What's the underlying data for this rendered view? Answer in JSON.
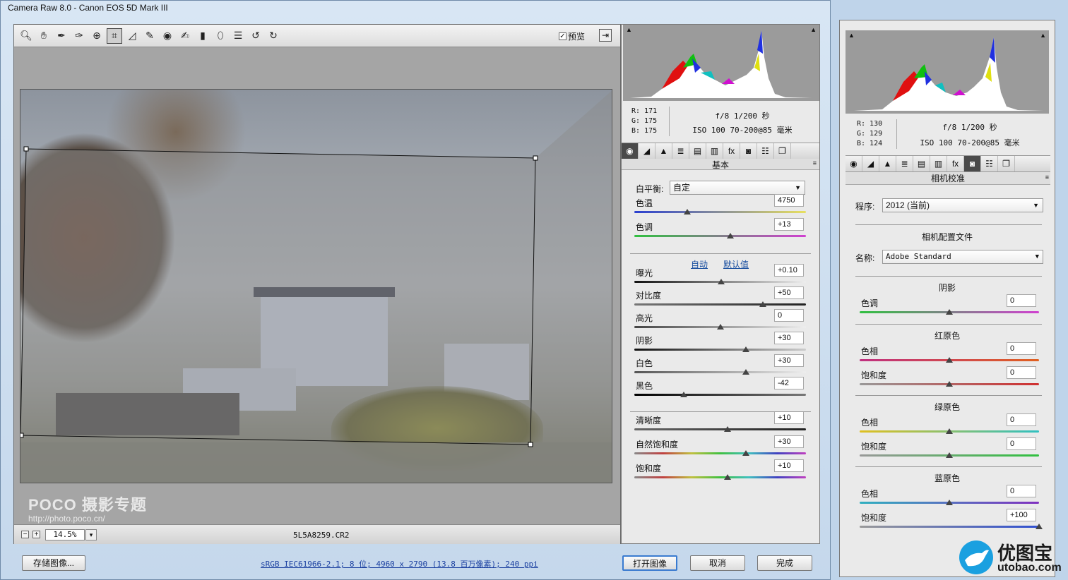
{
  "window": {
    "title": "Camera Raw 8.0 -  Canon EOS 5D Mark III"
  },
  "toolbar": {
    "preview_label": "预览",
    "preview_checked": "✓"
  },
  "statusbar": {
    "zoom": "14.5%",
    "filename": "5L5A8259.CR2",
    "minus": "−",
    "plus": "+",
    "dd": "▾"
  },
  "watermark": {
    "brand": "POCO 摄影专题",
    "url": "http://photo.poco.cn/"
  },
  "histogram": {
    "r": "R:  171",
    "g": "G:  175",
    "b": "B:  175",
    "aperture": "f/8   1/200 秒",
    "iso": "ISO 100   70-200@85 毫米"
  },
  "basic": {
    "title": "基本",
    "wb_label": "白平衡:",
    "wb_value": "自定",
    "auto": "自动",
    "default": "默认值",
    "sliders": [
      {
        "label": "色温",
        "value": "4750",
        "pos": 0.31,
        "grad": "linear-gradient(90deg,#2a3fd0,#e8e060)"
      },
      {
        "label": "色调",
        "value": "+13",
        "pos": 0.56,
        "grad": "linear-gradient(90deg,#30c040,#d040d0)"
      },
      {
        "label": "曝光",
        "value": "+0.10",
        "pos": 0.505,
        "grad": "linear-gradient(90deg,#111,#eee)"
      },
      {
        "label": "对比度",
        "value": "+50",
        "pos": 0.75,
        "grad": "linear-gradient(90deg,#777,#222)"
      },
      {
        "label": "高光",
        "value": "0",
        "pos": 0.5,
        "grad": "linear-gradient(90deg,#444,#eee)"
      },
      {
        "label": "阴影",
        "value": "+30",
        "pos": 0.65,
        "grad": "linear-gradient(90deg,#111,#ccc)"
      },
      {
        "label": "白色",
        "value": "+30",
        "pos": 0.65,
        "grad": "linear-gradient(90deg,#555,#eee)"
      },
      {
        "label": "黑色",
        "value": "-42",
        "pos": 0.29,
        "grad": "linear-gradient(90deg,#000,#777)"
      },
      {
        "label": "清晰度",
        "value": "+10",
        "pos": 0.545,
        "grad": "linear-gradient(90deg,#666,#222)"
      },
      {
        "label": "自然饱和度",
        "value": "+30",
        "pos": 0.65,
        "grad": "linear-gradient(90deg,#888,#c04040,#c0c040,#40c040,#40c0c0,#4040c0,#c040c0)"
      },
      {
        "label": "饱和度",
        "value": "+10",
        "pos": 0.545,
        "grad": "linear-gradient(90deg,#888,#c04040,#c0c040,#40c040,#40c0c0,#4040c0,#c040c0)"
      }
    ]
  },
  "footer": {
    "save": "存储图像...",
    "info": "sRGB IEC61966-2.1; 8 位; 4960 x 2790 (13.8 百万像素); 240 ppi",
    "open": "打开图像",
    "cancel": "取消",
    "done": "完成"
  },
  "calib": {
    "histogram": {
      "r": "R:  130",
      "g": "G:  129",
      "b": "B:  124",
      "aperture": "f/8   1/200 秒",
      "iso": "ISO 100   70-200@85 毫米"
    },
    "title": "相机校准",
    "process_label": "程序:",
    "process_value": "2012 (当前)",
    "profile_heading": "相机配置文件",
    "name_label": "名称:",
    "name_value": "Adobe Standard",
    "groups": [
      {
        "heading": "阴影",
        "rows": [
          {
            "label": "色调",
            "value": "0",
            "pos": 0.5,
            "grad": "linear-gradient(90deg,#30c040,#d040d0)"
          }
        ]
      },
      {
        "heading": "红原色",
        "rows": [
          {
            "label": "色相",
            "value": "0",
            "pos": 0.5,
            "grad": "linear-gradient(90deg,#c03080,#e06020)"
          },
          {
            "label": "饱和度",
            "value": "0",
            "pos": 0.5,
            "grad": "linear-gradient(90deg,#999,#d03030)"
          }
        ]
      },
      {
        "heading": "绿原色",
        "rows": [
          {
            "label": "色相",
            "value": "0",
            "pos": 0.5,
            "grad": "linear-gradient(90deg,#e0c020,#30c0c0)"
          },
          {
            "label": "饱和度",
            "value": "0",
            "pos": 0.5,
            "grad": "linear-gradient(90deg,#999,#30c040)"
          }
        ]
      },
      {
        "heading": "蓝原色",
        "rows": [
          {
            "label": "色相",
            "value": "0",
            "pos": 0.5,
            "grad": "linear-gradient(90deg,#30b0c0,#8030c0)"
          },
          {
            "label": "饱和度",
            "value": "+100",
            "pos": 1.0,
            "grad": "linear-gradient(90deg,#999,#3050d0)"
          }
        ]
      }
    ]
  },
  "logo": {
    "text": "优图宝",
    "url": "utobao.com"
  }
}
